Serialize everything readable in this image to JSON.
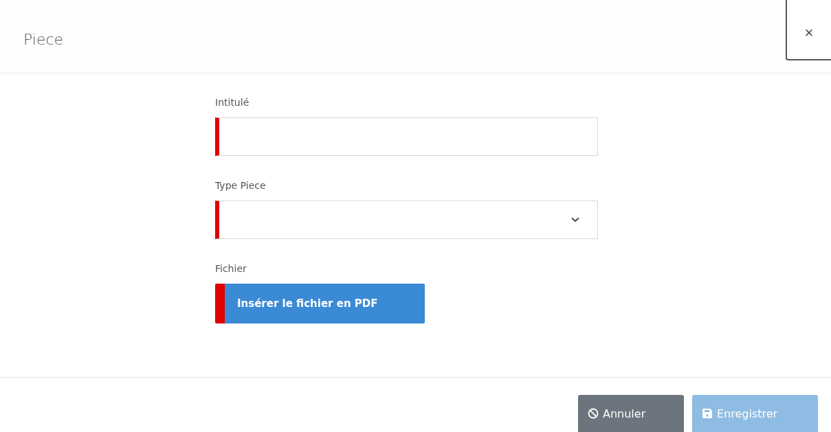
{
  "dialog": {
    "title": "Piece",
    "close_label": "×"
  },
  "fields": [
    {
      "kind": "text",
      "label": "Intitulé",
      "required": true
    },
    {
      "kind": "select",
      "label": "Type Piece",
      "required": true
    },
    {
      "kind": "file",
      "label": "Fichier",
      "required": true,
      "button": "Insérer le fichier en PDF"
    }
  ],
  "buttons": [
    {
      "kind": "cancel",
      "label": "Annuler",
      "disabled": false
    },
    {
      "kind": "save",
      "label": "Enregistrer",
      "disabled": true
    }
  ]
}
